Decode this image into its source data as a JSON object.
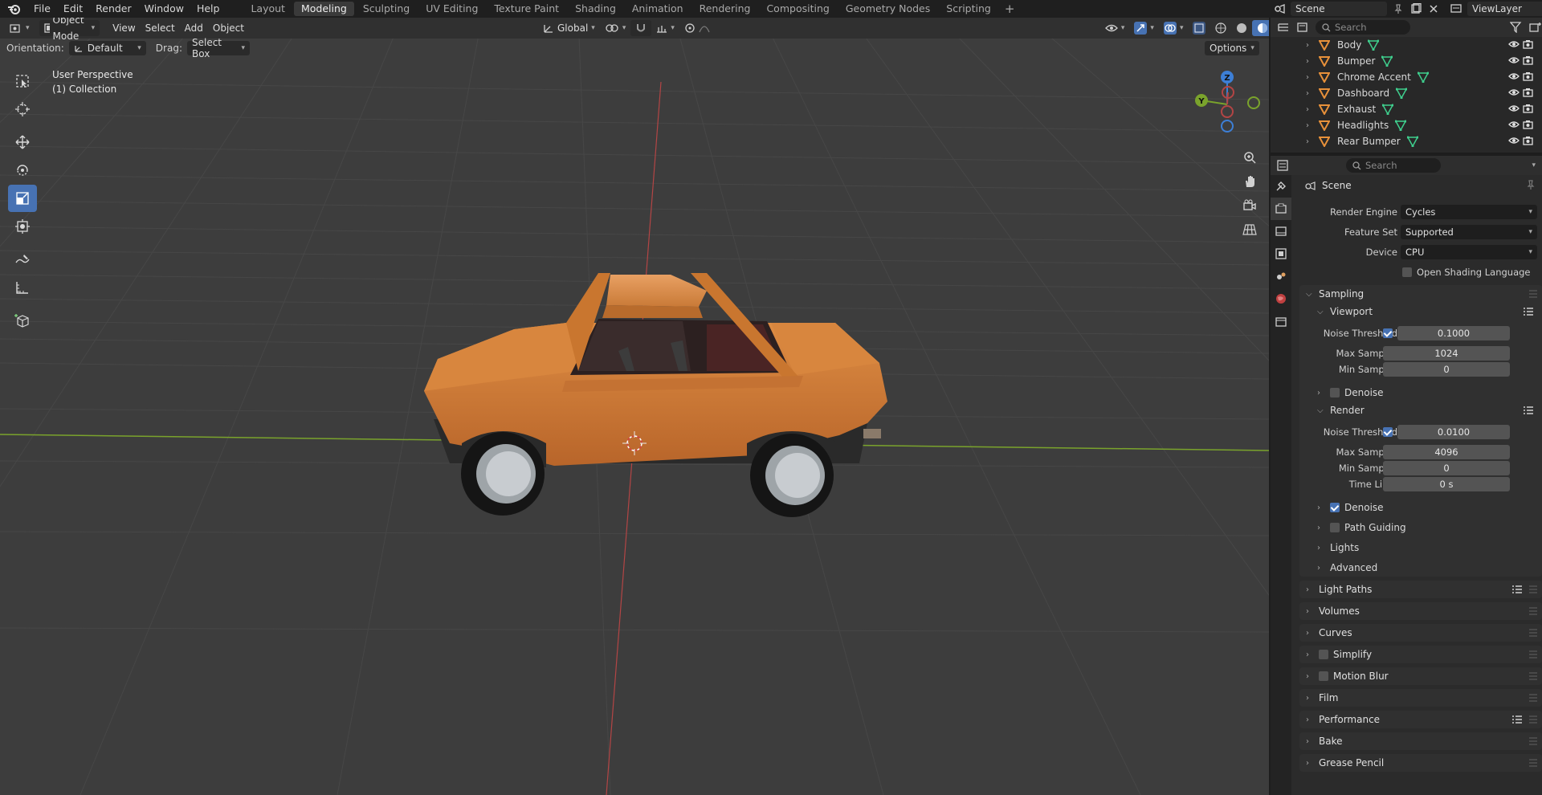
{
  "topbar": {
    "menus": [
      "File",
      "Edit",
      "Render",
      "Window",
      "Help"
    ],
    "workspaces": [
      "Layout",
      "Modeling",
      "Sculpting",
      "UV Editing",
      "Texture Paint",
      "Shading",
      "Animation",
      "Rendering",
      "Compositing",
      "Geometry Nodes",
      "Scripting"
    ],
    "active_workspace": "Modeling",
    "scene": "Scene",
    "view_layer": "ViewLayer"
  },
  "viewport": {
    "mode": "Object Mode",
    "menus": [
      "View",
      "Select",
      "Add",
      "Object"
    ],
    "transform_orientation": "Global",
    "orientation_label": "Orientation:",
    "orientation_value": "Default",
    "drag_label": "Drag:",
    "drag_value": "Select Box",
    "options_label": "Options",
    "info_line1": "User Perspective",
    "info_line2": "(1) Collection",
    "gizmo": {
      "z": "Z",
      "y": "Y"
    }
  },
  "outliner": {
    "search_placeholder": "Search",
    "items": [
      {
        "name": "Body"
      },
      {
        "name": "Bumper"
      },
      {
        "name": "Chrome Accent"
      },
      {
        "name": "Dashboard"
      },
      {
        "name": "Exhaust"
      },
      {
        "name": "Headlights"
      },
      {
        "name": "Rear Bumper"
      }
    ]
  },
  "properties": {
    "search_placeholder": "Search",
    "context": "Scene",
    "render_engine_label": "Render Engine",
    "render_engine": "Cycles",
    "feature_set_label": "Feature Set",
    "feature_set": "Supported",
    "device_label": "Device",
    "device": "CPU",
    "osl_label": "Open Shading Language",
    "sampling": {
      "title": "Sampling",
      "viewport": {
        "title": "Viewport",
        "noise_threshold_label": "Noise Threshold",
        "noise_threshold": "0.1000",
        "max_samples_label": "Max Samples",
        "max_samples": "1024",
        "min_samples_label": "Min Samples",
        "min_samples": "0",
        "denoise_label": "Denoise"
      },
      "render": {
        "title": "Render",
        "noise_threshold_label": "Noise Threshold",
        "noise_threshold": "0.0100",
        "max_samples_label": "Max Samples",
        "max_samples": "4096",
        "min_samples_label": "Min Samples",
        "min_samples": "0",
        "time_limit_label": "Time Limit",
        "time_limit": "0 s",
        "denoise_label": "Denoise"
      },
      "path_guiding_label": "Path Guiding",
      "lights_label": "Lights",
      "advanced_label": "Advanced"
    },
    "panels": [
      "Light Paths",
      "Volumes",
      "Curves",
      "Simplify",
      "Motion Blur",
      "Film",
      "Performance",
      "Bake",
      "Grease Pencil"
    ]
  },
  "colors": {
    "accent": "#4772b3",
    "car_body": "#c8782f",
    "x_axis": "#b34545",
    "y_axis": "#7aa32c",
    "z_axis": "#3d7fd6"
  }
}
